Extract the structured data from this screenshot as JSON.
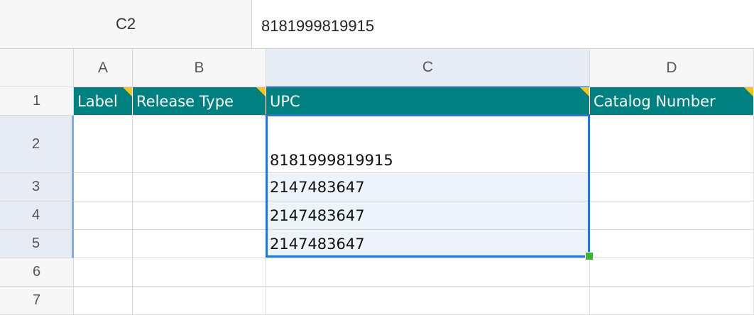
{
  "formula_bar": {
    "cell_ref": "C2",
    "value": "8181999819915"
  },
  "columns": [
    "A",
    "B",
    "C",
    "D"
  ],
  "rows": [
    "1",
    "2",
    "3",
    "4",
    "5",
    "6",
    "7"
  ],
  "headers": {
    "a": "Label",
    "b": "Release Type",
    "c": "UPC",
    "d": "Catalog Number"
  },
  "upc_values": {
    "r2": "8181999819915",
    "r3": "2147483647",
    "r4": "2147483647",
    "r5": "2147483647"
  },
  "colors": {
    "header_bg": "#008080",
    "header_text": "#ffffff",
    "note_marker": "#f5c518",
    "selection_border": "#2a74d6",
    "fill_handle": "#3cb22e"
  }
}
